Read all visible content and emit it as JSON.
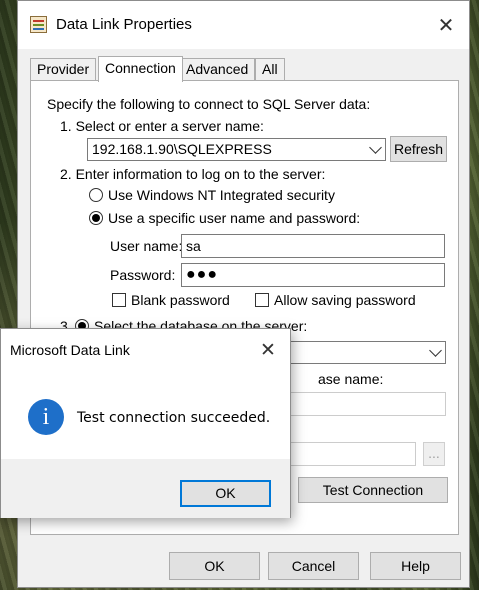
{
  "window": {
    "title": "Data Link Properties",
    "tabs": [
      {
        "label": "Provider",
        "active": false
      },
      {
        "label": "Connection",
        "active": true
      },
      {
        "label": "Advanced",
        "active": false
      },
      {
        "label": "All",
        "active": false
      }
    ],
    "intro": "Specify the following to connect to SQL Server data:",
    "step1": {
      "label": "1. Select or enter a server name:",
      "server_value": "192.168.1.90\\SQLEXPRESS",
      "refresh_label": "Refresh"
    },
    "step2": {
      "label": "2. Enter information to log on to the server:",
      "radio_nt": "Use Windows NT Integrated security",
      "radio_specific": "Use a specific user name and password:",
      "selected": "specific",
      "username_label": "User name:",
      "username_value": "sa",
      "password_label": "Password:",
      "password_value": "●●●",
      "blank_password_label": "Blank password",
      "allow_saving_label": "Allow saving password"
    },
    "step3": {
      "prefix": "3.",
      "radio_select_db": "Select the database on the server:",
      "partial_label": "ase name:",
      "browse_label": "..."
    },
    "test_connection_label": "Test Connection",
    "footer": {
      "ok_label": "OK",
      "cancel_label": "Cancel",
      "help_label": "Help"
    }
  },
  "message_box": {
    "title": "Microsoft Data Link",
    "icon": "info-icon",
    "icon_glyph": "i",
    "message": "Test connection succeeded.",
    "ok_label": "OK"
  },
  "colors": {
    "accent": "#0078d7",
    "info_icon": "#1e6fc9"
  }
}
